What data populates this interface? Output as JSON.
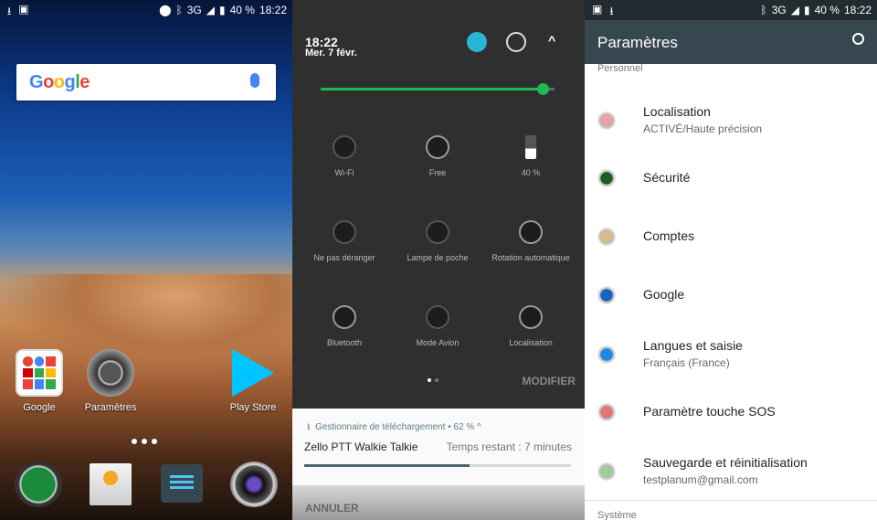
{
  "home": {
    "status": {
      "battery": "40 %",
      "time": "18:22",
      "network": "3G"
    },
    "search": {
      "logo": "Google"
    },
    "apps": [
      {
        "label": "Google"
      },
      {
        "label": "Paramètres"
      },
      {
        "label": "Play Store"
      }
    ],
    "dock": [
      "phone-icon",
      "contacts-icon",
      "messages-icon",
      "camera-icon"
    ]
  },
  "quick": {
    "time": "18:22",
    "date": "Mer. 7 févr.",
    "brightness_percent": 95,
    "tiles": [
      {
        "label": "Wi-Fi"
      },
      {
        "label": "Free"
      },
      {
        "label": "40 %"
      },
      {
        "label": "Ne pas déranger"
      },
      {
        "label": "Lampe de poche"
      },
      {
        "label": "Rotation automatique"
      },
      {
        "label": "Bluetooth"
      },
      {
        "label": "Mode Avion"
      },
      {
        "label": "Localisation"
      }
    ],
    "edit": "MODIFIER",
    "notification": {
      "app": "Gestionnaire de téléchargement • 62 % ^",
      "title": "Zello PTT Walkie Talkie",
      "remaining": "Temps restant : 7 minutes",
      "progress_percent": 62,
      "action": "ANNULER"
    },
    "accent": "#1db954"
  },
  "settings": {
    "status": {
      "battery": "40 %",
      "time": "18:22",
      "network": "3G"
    },
    "title": "Paramètres",
    "section1": "Personnel",
    "items": [
      {
        "title": "Localisation",
        "subtitle": "ACTIVÉ/Haute précision"
      },
      {
        "title": "Sécurité"
      },
      {
        "title": "Comptes"
      },
      {
        "title": "Google"
      },
      {
        "title": "Langues et saisie",
        "subtitle": "Français (France)"
      },
      {
        "title": "Paramètre touche SOS"
      },
      {
        "title": "Sauvegarde et réinitialisation",
        "subtitle": "testplanum@gmail.com"
      }
    ],
    "section2": "Système",
    "toolbar_color": "#37474f"
  }
}
